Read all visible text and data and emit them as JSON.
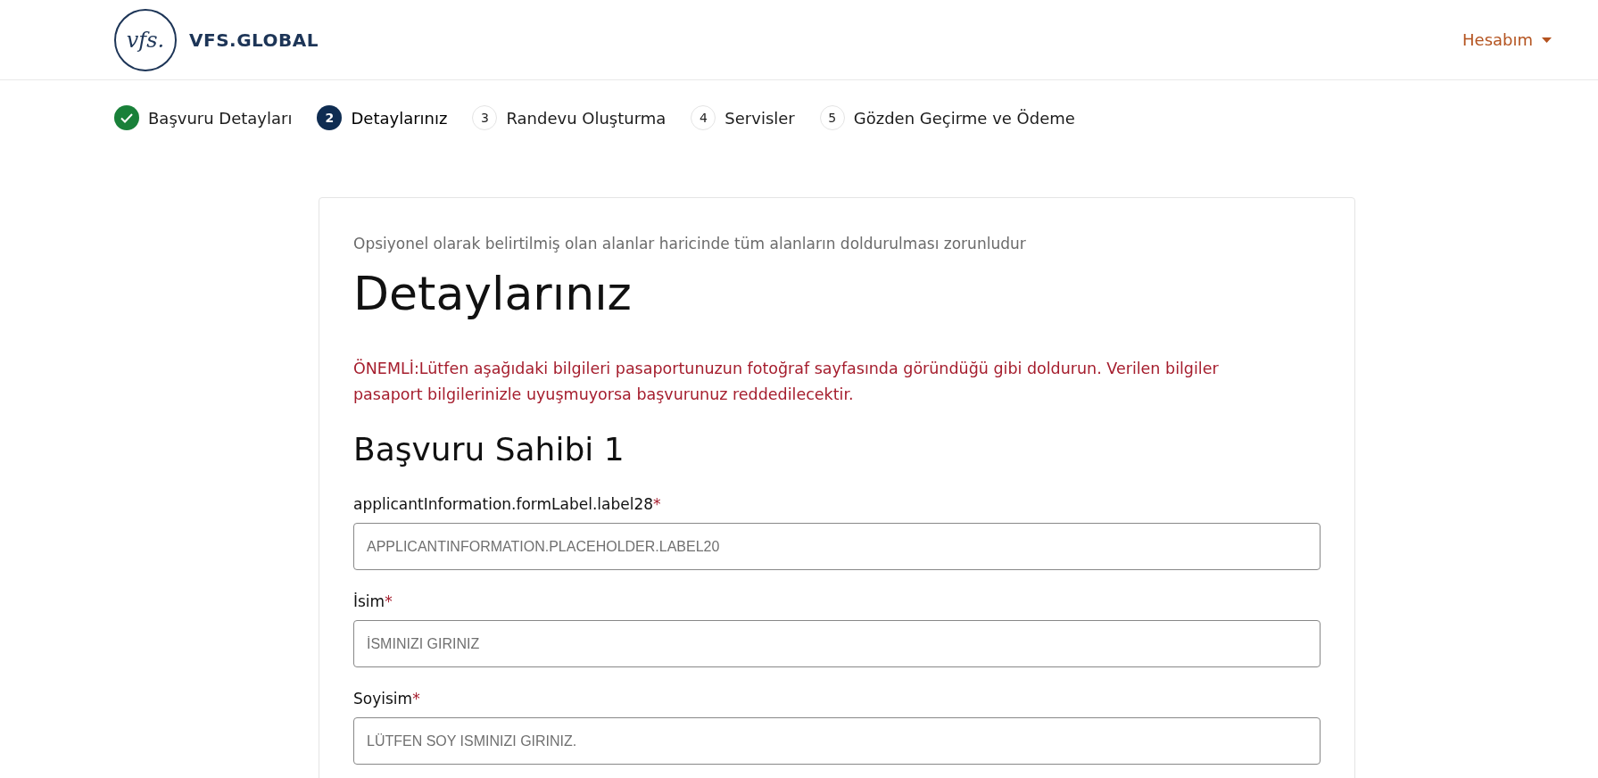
{
  "header": {
    "logo": {
      "mark": "vfs.",
      "name": "VFS.GLOBAL"
    },
    "account_menu": {
      "label": "Hesabım"
    }
  },
  "steps": [
    {
      "label": "Başvuru Detayları",
      "completed": true,
      "selected": false
    },
    {
      "number": "2",
      "label": "Detaylarınız",
      "completed": false,
      "selected": true
    },
    {
      "number": "3",
      "label": "Randevu Oluşturma",
      "completed": false,
      "selected": false
    },
    {
      "number": "4",
      "label": "Servisler",
      "completed": false,
      "selected": false
    },
    {
      "number": "5",
      "label": "Gözden Geçirme ve Ödeme",
      "completed": false,
      "selected": false
    }
  ],
  "form": {
    "note": "Opsiyonel olarak belirtilmiş olan alanlar haricinde tüm alanların doldurulması zorunludur",
    "title": "Detaylarınız",
    "warning": "ÖNEMLİ:Lütfen aşağıdaki bilgileri pasaportunuzun fotoğraf sayfasında göründüğü gibi doldurun. Verilen bilgiler pasaport bilgilerinizle uyuşmuyorsa başvurunuz reddedilecektir.",
    "section_title": "Başvuru Sahibi 1",
    "fields": [
      {
        "label": "applicantInformation.formLabel.label28",
        "required_mark": "*",
        "placeholder": "APPLICANTINFORMATION.PLACEHOLDER.LABEL20"
      },
      {
        "label": "İsim",
        "required_mark": "*",
        "placeholder": "İSMINIZI GIRINIZ"
      },
      {
        "label": "Soyisim",
        "required_mark": "*",
        "placeholder": "LÜTFEN SOY ISMINIZI GIRINIZ."
      }
    ]
  }
}
